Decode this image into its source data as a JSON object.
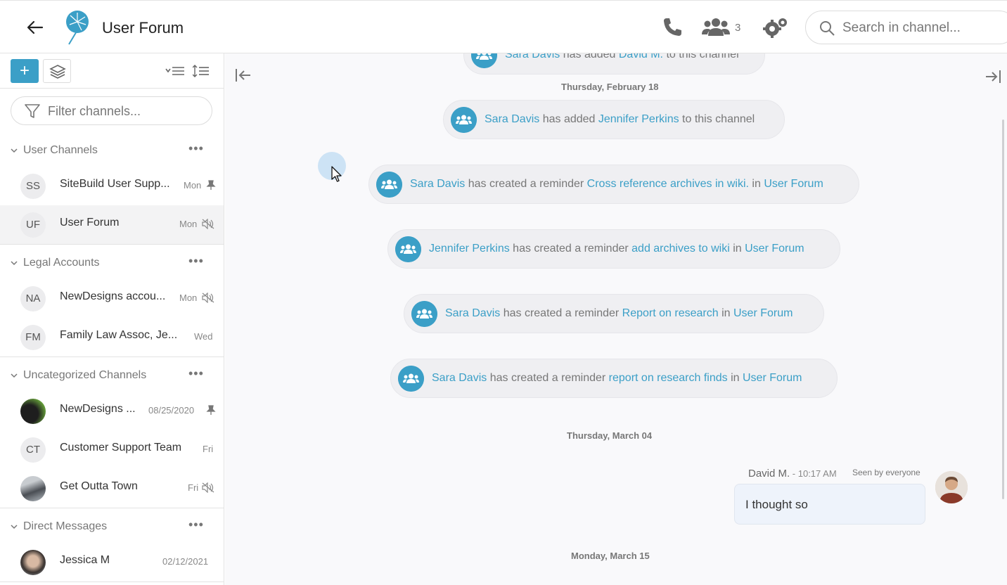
{
  "header": {
    "title": "User Forum",
    "member_count": "3",
    "search_placeholder": "Search in channel..."
  },
  "sidebar": {
    "filter_placeholder": "Filter channels...",
    "sections": [
      {
        "title": "User Channels",
        "more": "•••"
      },
      {
        "title": "Legal Accounts",
        "more": "•••"
      },
      {
        "title": "Uncategorized Channels",
        "more": "•••"
      },
      {
        "title": "Direct Messages",
        "more": "•••"
      }
    ],
    "channels": [
      {
        "initials": "SS",
        "name": "SiteBuild User Supp...",
        "time": "Mon",
        "icon": "pin-icon"
      },
      {
        "initials": "UF",
        "name": "User Forum",
        "time": "Mon",
        "icon": "muted-icon"
      },
      {
        "initials": "NA",
        "name": "NewDesigns accou...",
        "time": "Mon",
        "icon": "muted-icon"
      },
      {
        "initials": "FM",
        "name": "Family Law Assoc, Je...",
        "time": "Wed",
        "icon": ""
      },
      {
        "initials": "",
        "name": "NewDesigns ...",
        "time": "08/25/2020",
        "icon": "pin-icon"
      },
      {
        "initials": "CT",
        "name": "Customer Support Team",
        "time": "Fri",
        "icon": ""
      },
      {
        "initials": "",
        "name": "Get Outta Town",
        "time": "Fri",
        "icon": "muted-icon"
      },
      {
        "initials": "",
        "name": "Jessica M",
        "time": "02/12/2021",
        "icon": ""
      }
    ]
  },
  "main": {
    "dates": [
      "Thursday, February 18",
      "Thursday, March 04",
      "Monday, March 15"
    ],
    "events": [
      {
        "actor": "Sara Davis",
        "verb": " has added ",
        "target": "David M.",
        "suffix": " to this channel",
        "in": "",
        "place": ""
      },
      {
        "actor": "Sara Davis",
        "verb": " has added ",
        "target": "Jennifer Perkins",
        "suffix": " to this channel",
        "in": "",
        "place": ""
      },
      {
        "actor": "Sara Davis",
        "verb": " has created a reminder ",
        "target": "Cross reference archives in wiki.",
        "suffix": "",
        "in": " in ",
        "place": "User Forum"
      },
      {
        "actor": "Jennifer Perkins",
        "verb": " has created a reminder ",
        "target": "add archives to wiki",
        "suffix": "",
        "in": " in ",
        "place": "User Forum"
      },
      {
        "actor": "Sara Davis",
        "verb": " has created a reminder ",
        "target": "Report on research",
        "suffix": "",
        "in": " in ",
        "place": "User Forum"
      },
      {
        "actor": "Sara Davis",
        "verb": " has created a reminder ",
        "target": "report on research finds",
        "suffix": "",
        "in": " in ",
        "place": "User Forum"
      }
    ],
    "message": {
      "author": "David M.",
      "time": " - 10:17 AM",
      "seen": "Seen by everyone",
      "text": "I thought so"
    }
  },
  "colors": {
    "accent": "#3b9fc7",
    "event_bg": "#efeff2",
    "main_bg": "#f9f9fb"
  }
}
